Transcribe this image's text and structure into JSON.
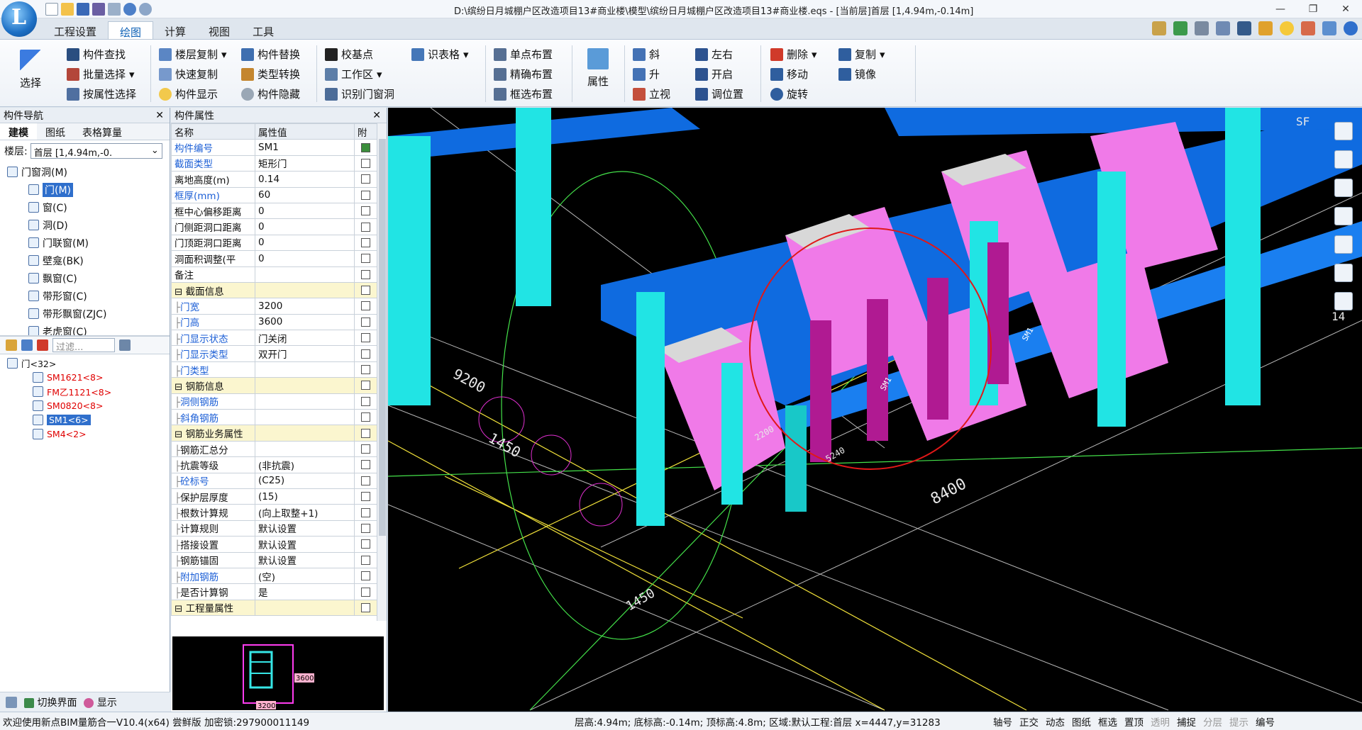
{
  "title": "D:\\缤纷日月城棚户区改造项目13#商业楼\\模型\\缤纷日月城棚户区改造项目13#商业楼.eqs - [当前层]首层 [1,4.94m,-0.14m]",
  "menu_tabs": [
    "工程设置",
    "绘图",
    "计算",
    "视图",
    "工具"
  ],
  "active_tab": "绘图",
  "ribbon": {
    "select": "选择",
    "find": "构件查找",
    "batch_select": "批量选择",
    "attr_select": "按属性选择",
    "floor_copy": "楼层复制",
    "quick_copy": "快速复制",
    "show": "构件显示",
    "replace": "构件替换",
    "type_convert": "类型转换",
    "hide": "构件隐藏",
    "base_point": "校基点",
    "work_area": "工作区",
    "identify_door": "识别门窗洞",
    "identify_table": "识表格",
    "single_place": "单点布置",
    "precise_place": "精确布置",
    "box_place": "框选布置",
    "properties": "属性",
    "slant": "斜",
    "raise": "升",
    "stand": "立视",
    "left_right": "左右",
    "open": "开启",
    "adjust_pos": "调位置",
    "delete": "删除",
    "move": "移动",
    "rotate": "旋转",
    "copy": "复制",
    "mirror": "镜像"
  },
  "nav_panel": {
    "title": "构件导航",
    "subtabs": [
      "建模",
      "图纸",
      "表格算量"
    ],
    "floor_label": "楼层:",
    "floor_value": "首层 [1,4.94m,-0.",
    "tree": [
      {
        "label": "门窗洞(M)",
        "level": 0
      },
      {
        "label": "门(M)",
        "level": 1,
        "selected": true
      },
      {
        "label": "窗(C)",
        "level": 1
      },
      {
        "label": "洞(D)",
        "level": 1
      },
      {
        "label": "门联窗(M)",
        "level": 1
      },
      {
        "label": "壁龛(BK)",
        "level": 1
      },
      {
        "label": "飘窗(C)",
        "level": 1
      },
      {
        "label": "带形窗(C)",
        "level": 1
      },
      {
        "label": "带形飘窗(ZJC)",
        "level": 1
      },
      {
        "label": "老虎窗(C)",
        "level": 1
      }
    ],
    "filter_placeholder": "过滤...",
    "components": [
      {
        "label": "门<32>",
        "level": 0,
        "color": "#111"
      },
      {
        "label": "SM1621<8>",
        "level": 1,
        "color": "#e00000"
      },
      {
        "label": "FM乙1121<8>",
        "level": 1,
        "color": "#e00000"
      },
      {
        "label": "SM0820<8>",
        "level": 1,
        "color": "#e00000"
      },
      {
        "label": "SM1<6>",
        "level": 1,
        "color": "#ffffff",
        "selected": true
      },
      {
        "label": "SM4<2>",
        "level": 1,
        "color": "#e00000"
      }
    ],
    "bottom_switch": "切换界面",
    "bottom_show": "显示"
  },
  "props_panel": {
    "title": "构件属性",
    "headers": [
      "名称",
      "属性值",
      "附"
    ],
    "rows": [
      {
        "name": "构件编号",
        "value": "SM1",
        "blue": true,
        "checked": true
      },
      {
        "name": "截面类型",
        "value": "矩形门",
        "blue": true
      },
      {
        "name": "离地高度(m)",
        "value": "0.14"
      },
      {
        "name": "框厚(mm)",
        "value": "60",
        "blue": true
      },
      {
        "name": "框中心偏移距离",
        "value": "0"
      },
      {
        "name": "门侧距洞口距离",
        "value": "0"
      },
      {
        "name": "门顶距洞口距离",
        "value": "0"
      },
      {
        "name": "洞面积调整(平",
        "value": "0"
      },
      {
        "name": "备注",
        "value": ""
      },
      {
        "name": "截面信息",
        "value": "",
        "group": true
      },
      {
        "name": "门宽",
        "value": "3200",
        "blue": true,
        "child": true
      },
      {
        "name": "门高",
        "value": "3600",
        "blue": true,
        "child": true
      },
      {
        "name": "门显示状态",
        "value": "门关闭",
        "blue": true,
        "child": true
      },
      {
        "name": "门显示类型",
        "value": "双开门",
        "blue": true,
        "child": true
      },
      {
        "name": "门类型",
        "value": "",
        "blue": true,
        "child": true
      },
      {
        "name": "钢筋信息",
        "value": "",
        "group": true
      },
      {
        "name": "洞侧钢筋",
        "value": "",
        "blue": true,
        "child": true
      },
      {
        "name": "斜角钢筋",
        "value": "",
        "blue": true,
        "child": true
      },
      {
        "name": "钢筋业务属性",
        "value": "",
        "group": true
      },
      {
        "name": "钢筋汇总分",
        "value": "",
        "child": true
      },
      {
        "name": "抗震等级",
        "value": "(非抗震)",
        "child": true
      },
      {
        "name": "砼标号",
        "value": "(C25)",
        "blue": true,
        "child": true
      },
      {
        "name": "保护层厚度",
        "value": "(15)",
        "child": true
      },
      {
        "name": "根数计算规",
        "value": "(向上取整+1)",
        "child": true
      },
      {
        "name": "计算规则",
        "value": "默认设置",
        "child": true
      },
      {
        "name": "搭接设置",
        "value": "默认设置",
        "child": true
      },
      {
        "name": "钢筋锚固",
        "value": "默认设置",
        "child": true
      },
      {
        "name": "附加钢筋",
        "value": "(空)",
        "blue": true,
        "child": true
      },
      {
        "name": "是否计算钢",
        "value": "是",
        "child": true
      },
      {
        "name": "工程量属性",
        "value": "",
        "group": true
      }
    ],
    "preview_height": "3600",
    "preview_width": "3200"
  },
  "viewport_labels": [
    "9200",
    "1450",
    "8400",
    "5240",
    "2200",
    "SM1",
    "SM1",
    "SF",
    "14",
    "1450"
  ],
  "status": {
    "left": "欢迎使用新点BIM量筋合一V10.4(x64) 尝鲜版 加密锁:297900011149",
    "mid": "层高:4.94m; 底标高:-0.14m; 顶标高:4.8m; 区域:默认工程:首层 x=4447,y=31283",
    "toggles": [
      "轴号",
      "正交",
      "动态",
      "图纸",
      "框选",
      "置顶",
      "透明",
      "捕捉",
      "分层",
      "提示",
      "编号"
    ],
    "dim_toggles": [
      "透明",
      "分层",
      "提示"
    ]
  },
  "colors": {
    "accent": "#0b5fb5",
    "viewport_bg": "#000000",
    "selection": "#2f6fcc"
  }
}
